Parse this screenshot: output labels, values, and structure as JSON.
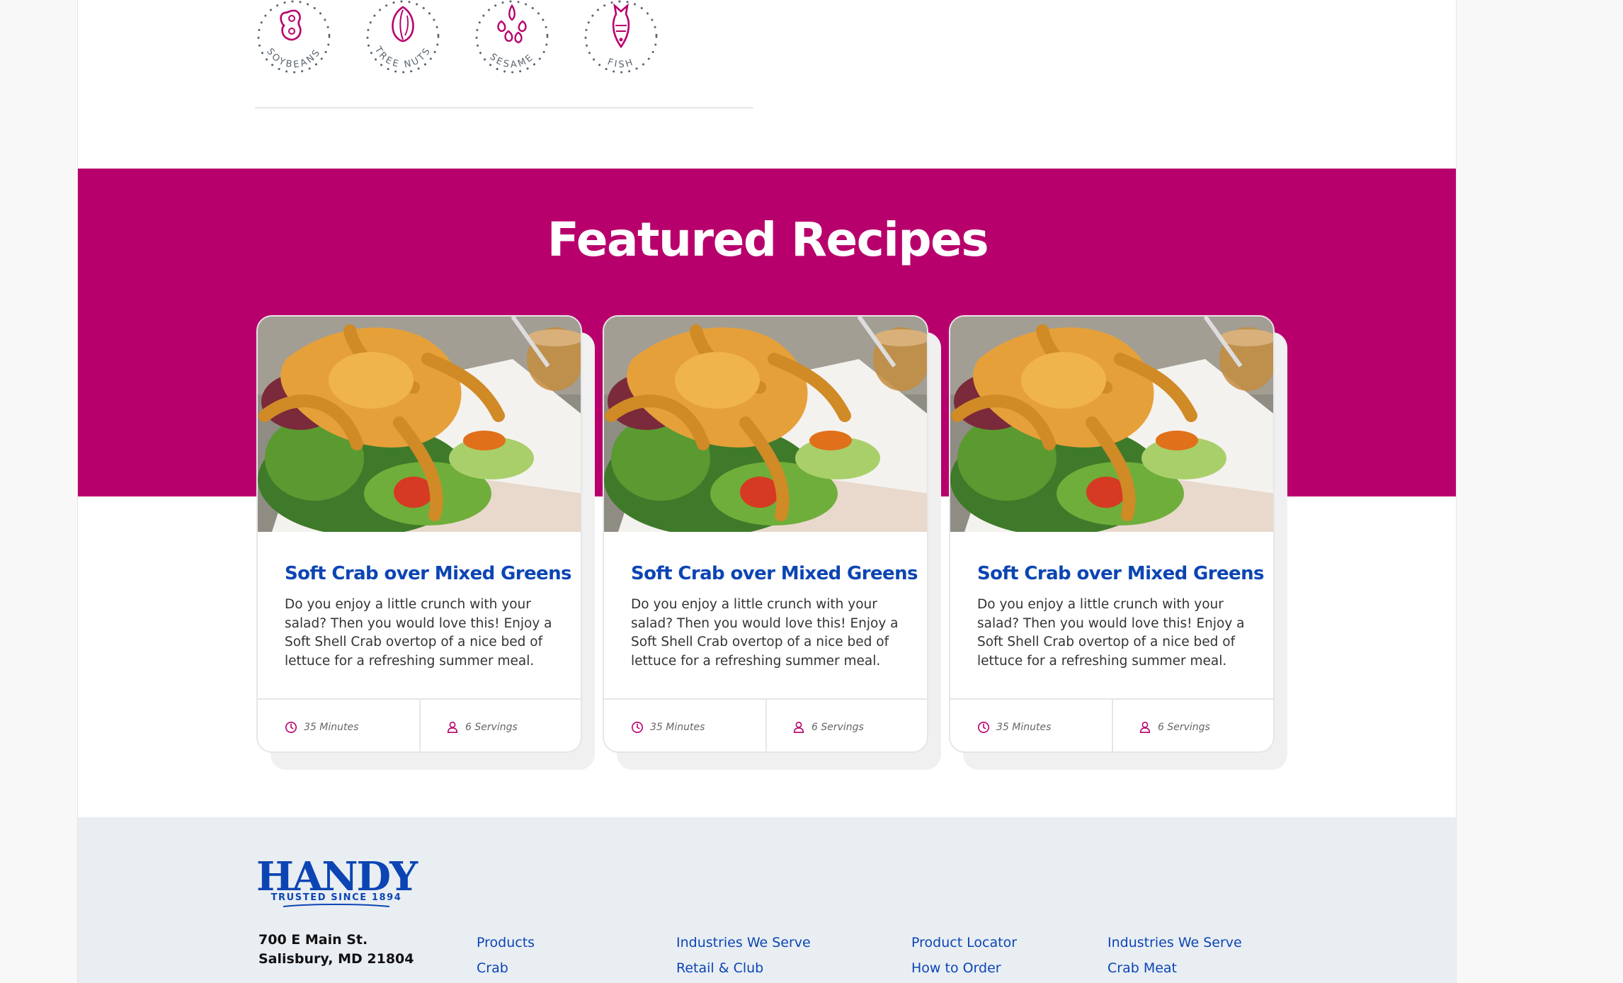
{
  "allergens": [
    {
      "label": "SOYBEANS",
      "icon": "soybean-icon"
    },
    {
      "label": "TREE NUTS",
      "icon": "almond-icon"
    },
    {
      "label": "SESAME",
      "icon": "sesame-icon"
    },
    {
      "label": "FISH",
      "icon": "fish-icon"
    }
  ],
  "featured": {
    "title": "Featured Recipes",
    "cards": [
      {
        "title": "Soft Crab over Mixed Greens",
        "description": "Do you enjoy a little crunch with your salad? Then you would love this! Enjoy a Soft Shell Crab overtop of a nice bed of lettuce for a refreshing summer meal.",
        "time": "35 Minutes",
        "servings": "6 Servings"
      },
      {
        "title": "Soft Crab over Mixed Greens",
        "description": "Do you enjoy a little crunch with your salad? Then you would love this! Enjoy a Soft Shell Crab overtop of a nice bed of lettuce for a refreshing summer meal.",
        "time": "35 Minutes",
        "servings": "6 Servings"
      },
      {
        "title": "Soft Crab over Mixed Greens",
        "description": "Do you enjoy a little crunch with your salad? Then you would love this! Enjoy a Soft Shell Crab overtop of a nice bed of lettuce for a refreshing summer meal.",
        "time": "35 Minutes",
        "servings": "6 Servings"
      }
    ]
  },
  "footer": {
    "logo_word": "HANDY",
    "logo_tagline": "TRUSTED SINCE 1894",
    "address_line1": "700 E Main St.",
    "address_line2": "Salisbury, MD 21804",
    "columns": [
      {
        "links": [
          "Products",
          "Crab"
        ]
      },
      {
        "links": [
          "Industries We Serve",
          "Retail & Club"
        ]
      },
      {
        "links": [
          "Product Locator",
          "How to Order"
        ]
      },
      {
        "links": [
          "Industries We Serve",
          "Crab Meat"
        ]
      }
    ]
  },
  "colors": {
    "brand_magenta": "#b8006c",
    "brand_blue": "#0c45b3",
    "footer_bg": "#e9eef3"
  }
}
